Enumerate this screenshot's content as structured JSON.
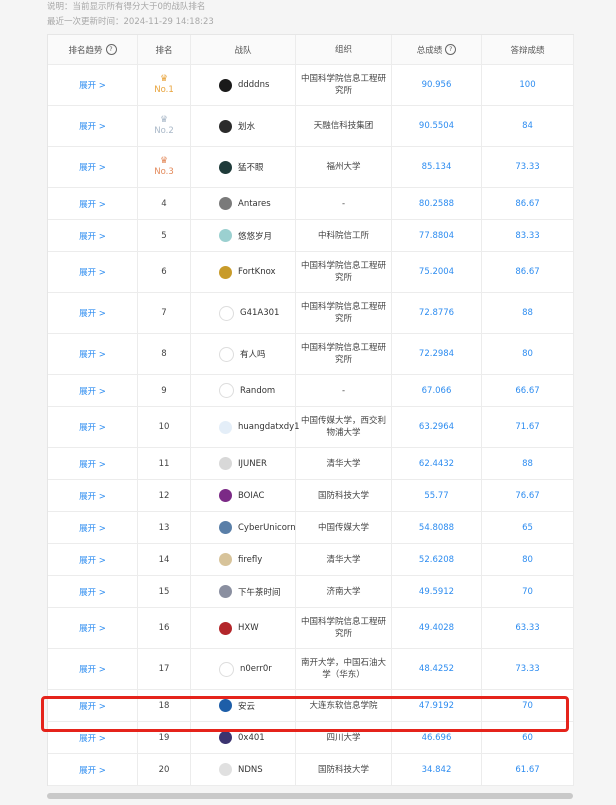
{
  "notes": {
    "line1": "说明：当前显示所有得分大于0的战队排名",
    "line2": "最近一次更新时间：2024-11-29 14:18:23"
  },
  "table": {
    "headers": {
      "trend": "排名趋势",
      "rank": "排名",
      "team": "战队",
      "org": "组织",
      "total": "总成绩",
      "answer": "答辩成绩"
    },
    "expand_label": "展开 >",
    "rows": [
      {
        "rank": "No.1",
        "medal": "gold",
        "team": "ddddns",
        "org": "中国科学院信息工程研究所",
        "total": "90.956",
        "answer": "100",
        "avatar_color": "#1a1a1a"
      },
      {
        "rank": "No.2",
        "medal": "silver",
        "team": "划水",
        "org": "天融信科技集团",
        "total": "90.5504",
        "answer": "84",
        "avatar_color": "#2b2b2b"
      },
      {
        "rank": "No.3",
        "medal": "bronze",
        "team": "猛不眼",
        "org": "福州大学",
        "total": "85.134",
        "answer": "73.33",
        "avatar_color": "#1f3b3a"
      },
      {
        "rank": "4",
        "team": "Antares",
        "org": "-",
        "total": "80.2588",
        "answer": "86.67",
        "avatar_color": "#7a7a7a"
      },
      {
        "rank": "5",
        "team": "悠悠岁月",
        "org": "中科院信工所",
        "total": "77.8804",
        "answer": "83.33",
        "avatar_color": "#9bd0d0"
      },
      {
        "rank": "6",
        "team": "FortKnox",
        "org": "中国科学院信息工程研究所",
        "total": "75.2004",
        "answer": "86.67",
        "avatar_color": "#c89b2a"
      },
      {
        "rank": "7",
        "team": "G41A301",
        "org": "中国科学院信息工程研究所",
        "total": "72.8776",
        "answer": "88",
        "avatar_color": "#ffffff"
      },
      {
        "rank": "8",
        "team": "有人吗",
        "org": "中国科学院信息工程研究所",
        "total": "72.2984",
        "answer": "80",
        "avatar_color": "#ffffff"
      },
      {
        "rank": "9",
        "team": "Random",
        "org": "-",
        "total": "67.066",
        "answer": "66.67",
        "avatar_color": "#ffffff"
      },
      {
        "rank": "10",
        "team": "huangdatxdy1",
        "org": "中国传媒大学，西交利物浦大学",
        "total": "63.2964",
        "answer": "71.67",
        "avatar_color": "#e4eef8"
      },
      {
        "rank": "11",
        "team": "IJUNER",
        "org": "清华大学",
        "total": "62.4432",
        "answer": "88",
        "avatar_color": "#d8d8d8"
      },
      {
        "rank": "12",
        "team": "BOIAC",
        "org": "国防科技大学",
        "total": "55.77",
        "answer": "76.67",
        "avatar_color": "#7b2a86"
      },
      {
        "rank": "13",
        "team": "CyberUnicorn",
        "org": "中国传媒大学",
        "total": "54.8088",
        "answer": "65",
        "avatar_color": "#5a7fa8"
      },
      {
        "rank": "14",
        "team": "firefly",
        "org": "清华大学",
        "total": "52.6208",
        "answer": "80",
        "avatar_color": "#d7c39a"
      },
      {
        "rank": "15",
        "team": "下午茶时间",
        "org": "济南大学",
        "total": "49.5912",
        "answer": "70",
        "avatar_color": "#8a8fa0"
      },
      {
        "rank": "16",
        "team": "HXW",
        "org": "中国科学院信息工程研究所",
        "total": "49.4028",
        "answer": "63.33",
        "avatar_color": "#b3262a"
      },
      {
        "rank": "17",
        "team": "n0err0r",
        "org": "南开大学，中国石油大学（华东）",
        "total": "48.4252",
        "answer": "73.33",
        "avatar_color": "#ffffff"
      },
      {
        "rank": "18",
        "team": "安云",
        "org": "大连东软信息学院",
        "total": "47.9192",
        "answer": "70",
        "avatar_color": "#1d5ea8"
      },
      {
        "rank": "19",
        "team": "0x401",
        "org": "四川大学",
        "total": "46.696",
        "answer": "60",
        "avatar_color": "#3b3470"
      },
      {
        "rank": "20",
        "team": "NDNS",
        "org": "国防科技大学",
        "total": "34.842",
        "answer": "61.67",
        "avatar_color": "#e0e0e0"
      }
    ]
  },
  "colors": {
    "accent": "#2d8cf0",
    "gold": "#e8a33a",
    "silver": "#a9b8c8",
    "bronze": "#e3895a",
    "highlight": "#e5231b"
  }
}
